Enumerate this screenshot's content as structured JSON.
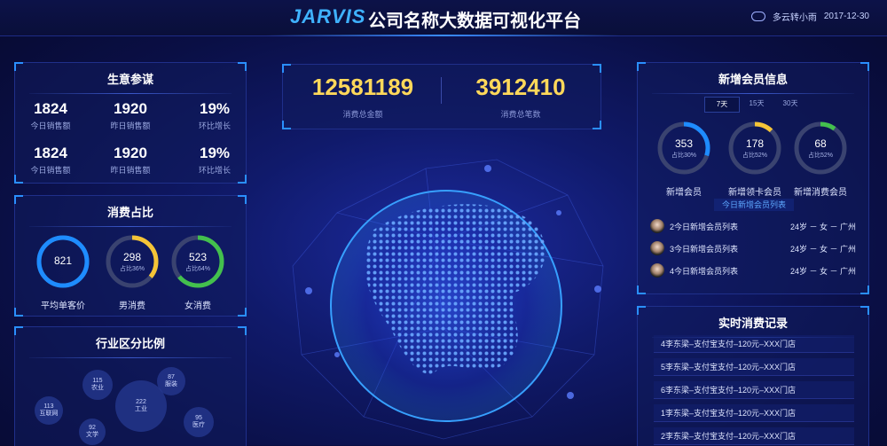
{
  "header": {
    "logo": "JARVIS",
    "title": "公司名称大数据可视化平台",
    "weather_icon": "cloud-rain-icon",
    "weather": "多云转小雨",
    "date": "2017-12-30"
  },
  "business": {
    "title": "生意参谋",
    "stats": [
      {
        "value": "1824",
        "label": "今日销售额"
      },
      {
        "value": "1920",
        "label": "昨日销售额"
      },
      {
        "value": "19%",
        "label": "环比增长"
      },
      {
        "value": "1824",
        "label": "今日销售额"
      },
      {
        "value": "1920",
        "label": "昨日销售额"
      },
      {
        "value": "19%",
        "label": "环比增长"
      }
    ]
  },
  "consumption": {
    "title": "消费占比",
    "rings": [
      {
        "value": "821",
        "sub": "",
        "label": "平均单客价",
        "color": "#1e8cff",
        "fraction": 1.0
      },
      {
        "value": "298",
        "sub": "占比36%",
        "label": "男消费",
        "color": "#f5c437",
        "fraction": 0.36
      },
      {
        "value": "523",
        "sub": "占比64%",
        "label": "女消费",
        "color": "#43c04d",
        "fraction": 0.64
      }
    ]
  },
  "industry": {
    "title": "行业区分比例",
    "bubbles": [
      {
        "value": "115",
        "label": "农业"
      },
      {
        "value": "87",
        "label": "服装"
      },
      {
        "value": "222",
        "label": "工业"
      },
      {
        "value": "113",
        "label": "互联网"
      },
      {
        "value": "95",
        "label": "医疗"
      },
      {
        "value": "92",
        "label": "文学"
      }
    ]
  },
  "kpis": [
    {
      "value": "12581189",
      "label": "消费总金额"
    },
    {
      "value": "3912410",
      "label": "消费总笔数"
    }
  ],
  "members": {
    "title": "新增会员信息",
    "tabs": [
      "7天",
      "15天",
      "30天"
    ],
    "active_tab": "7天",
    "rings": [
      {
        "value": "353",
        "sub": "占比30%",
        "label": "新增会员",
        "color": "#1e8cff",
        "fraction": 0.3
      },
      {
        "value": "178",
        "sub": "占比52%",
        "label": "新增领卡会员",
        "color": "#f5c437",
        "fraction": 0.12
      },
      {
        "value": "68",
        "sub": "占比52%",
        "label": "新增消费会员",
        "color": "#43c04d",
        "fraction": 0.1
      }
    ],
    "list_title": "今日新增会员列表",
    "list": [
      {
        "name": "2今日新增会员列表",
        "info": "24岁 － 女 － 广州"
      },
      {
        "name": "3今日新增会员列表",
        "info": "24岁 － 女 － 广州"
      },
      {
        "name": "4今日新增会员列表",
        "info": "24岁 － 女 － 广州"
      }
    ]
  },
  "records": {
    "title": "实时消费记录",
    "items": [
      "4李东梁–支付宝支付–120元–XXX门店",
      "5李东梁–支付宝支付–120元–XXX门店",
      "6李东梁–支付宝支付–120元–XXX门店",
      "1李东梁–支付宝支付–120元–XXX门店",
      "2李东梁–支付宝支付–120元–XXX门店"
    ]
  }
}
